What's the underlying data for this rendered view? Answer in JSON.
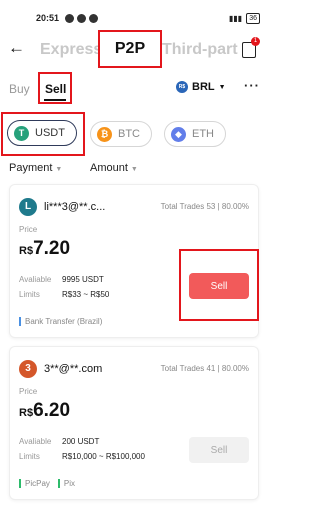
{
  "status": {
    "time": "20:51",
    "battery": "36"
  },
  "nav": {
    "tabs": [
      "Express",
      "P2P",
      "Third-part"
    ],
    "order_badge": "1"
  },
  "subtabs": {
    "buy": "Buy",
    "sell": "Sell",
    "currency": "BRL",
    "currency_icon": "R$"
  },
  "coins": [
    {
      "label": "USDT",
      "glyph": "T"
    },
    {
      "label": "BTC",
      "glyph": "₿"
    },
    {
      "label": "ETH",
      "glyph": "◆"
    }
  ],
  "filters": {
    "payment": "Payment",
    "amount": "Amount"
  },
  "labels": {
    "price": "Price",
    "available": "Avaliable",
    "limits": "Limits",
    "currency_symbol": "R$"
  },
  "ads": [
    {
      "avatar_letter": "L",
      "merchant": "li***3@**.c...",
      "trades": "Total Trades 53 | 80.00%",
      "price": "7.20",
      "available": "9995 USDT",
      "limits": "R$33 ~ R$50",
      "payments": [
        "Bank Transfer (Brazil)"
      ],
      "button": "Sell"
    },
    {
      "avatar_letter": "3",
      "merchant": "3**@**.com",
      "trades": "Total Trades 41 | 80.00%",
      "price": "6.20",
      "available": "200 USDT",
      "limits": "R$10,000 ~ R$100,000",
      "payments": [
        "PicPay",
        "Pix"
      ],
      "button": "Sell"
    }
  ]
}
